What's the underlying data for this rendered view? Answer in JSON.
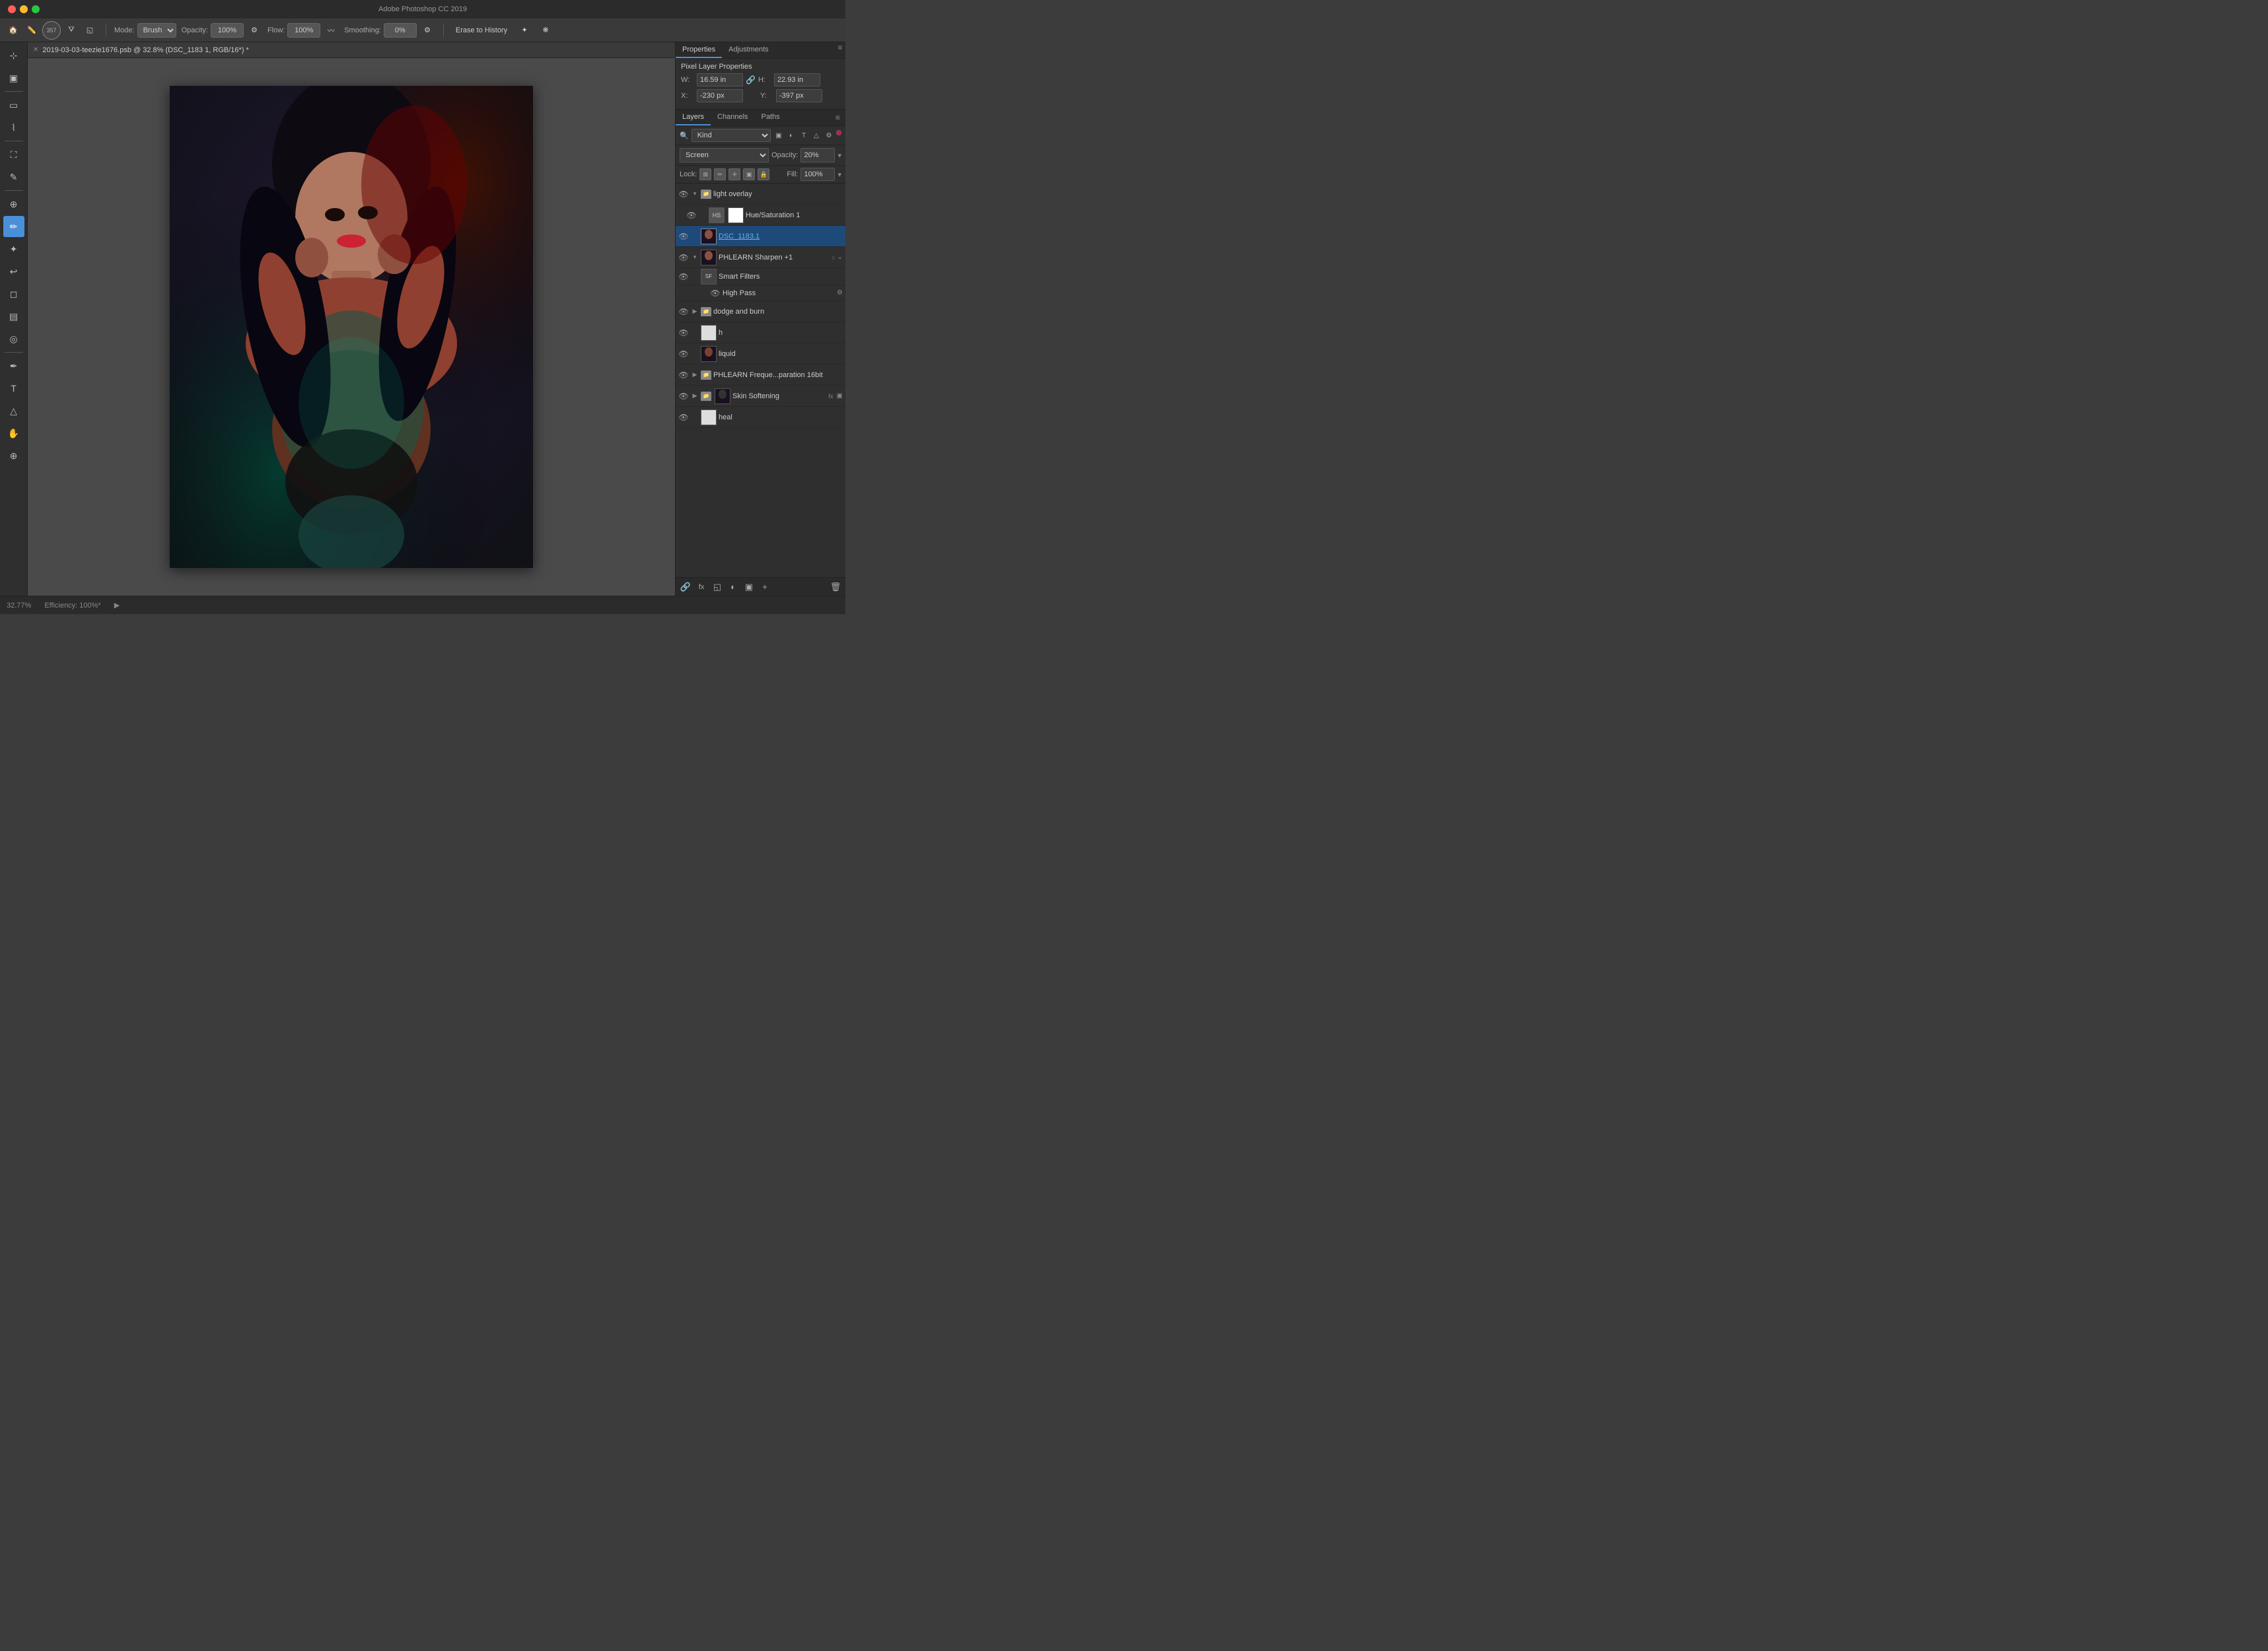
{
  "app": {
    "title": "Adobe Photoshop CC 2019",
    "window_controls": [
      "close",
      "minimize",
      "maximize"
    ]
  },
  "toolbar": {
    "brush_size": "357",
    "mode_label": "Mode:",
    "mode_value": "Brush",
    "opacity_label": "Opacity:",
    "opacity_value": "100%",
    "flow_label": "Flow:",
    "flow_value": "100%",
    "smoothing_label": "Smoothing:",
    "smoothing_value": "0%",
    "erase_to_history": "Erase to History"
  },
  "document": {
    "tab_title": "2019-03-03-teezie1676.psb @ 32.8% (DSC_1183 1, RGB/16*) *"
  },
  "properties": {
    "tabs": [
      "Properties",
      "Adjustments"
    ],
    "active_tab": "Properties",
    "pixel_layer_title": "Pixel Layer Properties",
    "w_label": "W:",
    "w_value": "16.59 in",
    "h_label": "H:",
    "h_value": "22.93 in",
    "x_label": "X:",
    "x_value": "-230 px",
    "y_label": "Y:",
    "y_value": "-397 px"
  },
  "layers_panel": {
    "tabs": [
      "Layers",
      "Channels",
      "Paths"
    ],
    "active_tab": "Layers",
    "filter_label": "Kind",
    "blend_mode": "Screen",
    "opacity_label": "Opacity:",
    "opacity_value": "20%",
    "lock_label": "Lock:",
    "fill_label": "Fill:",
    "fill_value": "100%",
    "layers": [
      {
        "name": "light overlay",
        "type": "group",
        "visible": true,
        "indent": 0,
        "expanded": true
      },
      {
        "name": "Hue/Saturation 1",
        "type": "adjustment",
        "visible": true,
        "indent": 1
      },
      {
        "name": "DSC_1183.1",
        "type": "pixel",
        "visible": true,
        "indent": 0,
        "selected": true,
        "is_link": true
      },
      {
        "name": "PHLEARN Sharpen +1",
        "type": "smart",
        "visible": true,
        "indent": 0,
        "expanded": true,
        "has_badge": true
      },
      {
        "name": "Smart Filters",
        "type": "smart-filters",
        "visible": true,
        "indent": 1
      },
      {
        "name": "High Pass",
        "type": "filter",
        "visible": true,
        "indent": 2
      },
      {
        "name": "dodge and burn",
        "type": "group",
        "visible": true,
        "indent": 0,
        "expanded": false
      },
      {
        "name": "h",
        "type": "pixel",
        "visible": true,
        "indent": 0
      },
      {
        "name": "liquid",
        "type": "pixel",
        "visible": true,
        "indent": 0
      },
      {
        "name": "PHLEARN Freque...paration 16bit",
        "type": "group",
        "visible": true,
        "indent": 0,
        "expanded": false
      },
      {
        "name": "Skin Softening",
        "type": "group",
        "visible": true,
        "indent": 0,
        "expanded": false,
        "has_fx": true
      },
      {
        "name": "heal",
        "type": "pixel",
        "visible": true,
        "indent": 0
      }
    ],
    "bottom_icons": [
      "link",
      "fx",
      "new-group",
      "new-layer",
      "delete"
    ]
  },
  "statusbar": {
    "zoom": "32.77%",
    "efficiency": "Efficiency: 100%*"
  }
}
